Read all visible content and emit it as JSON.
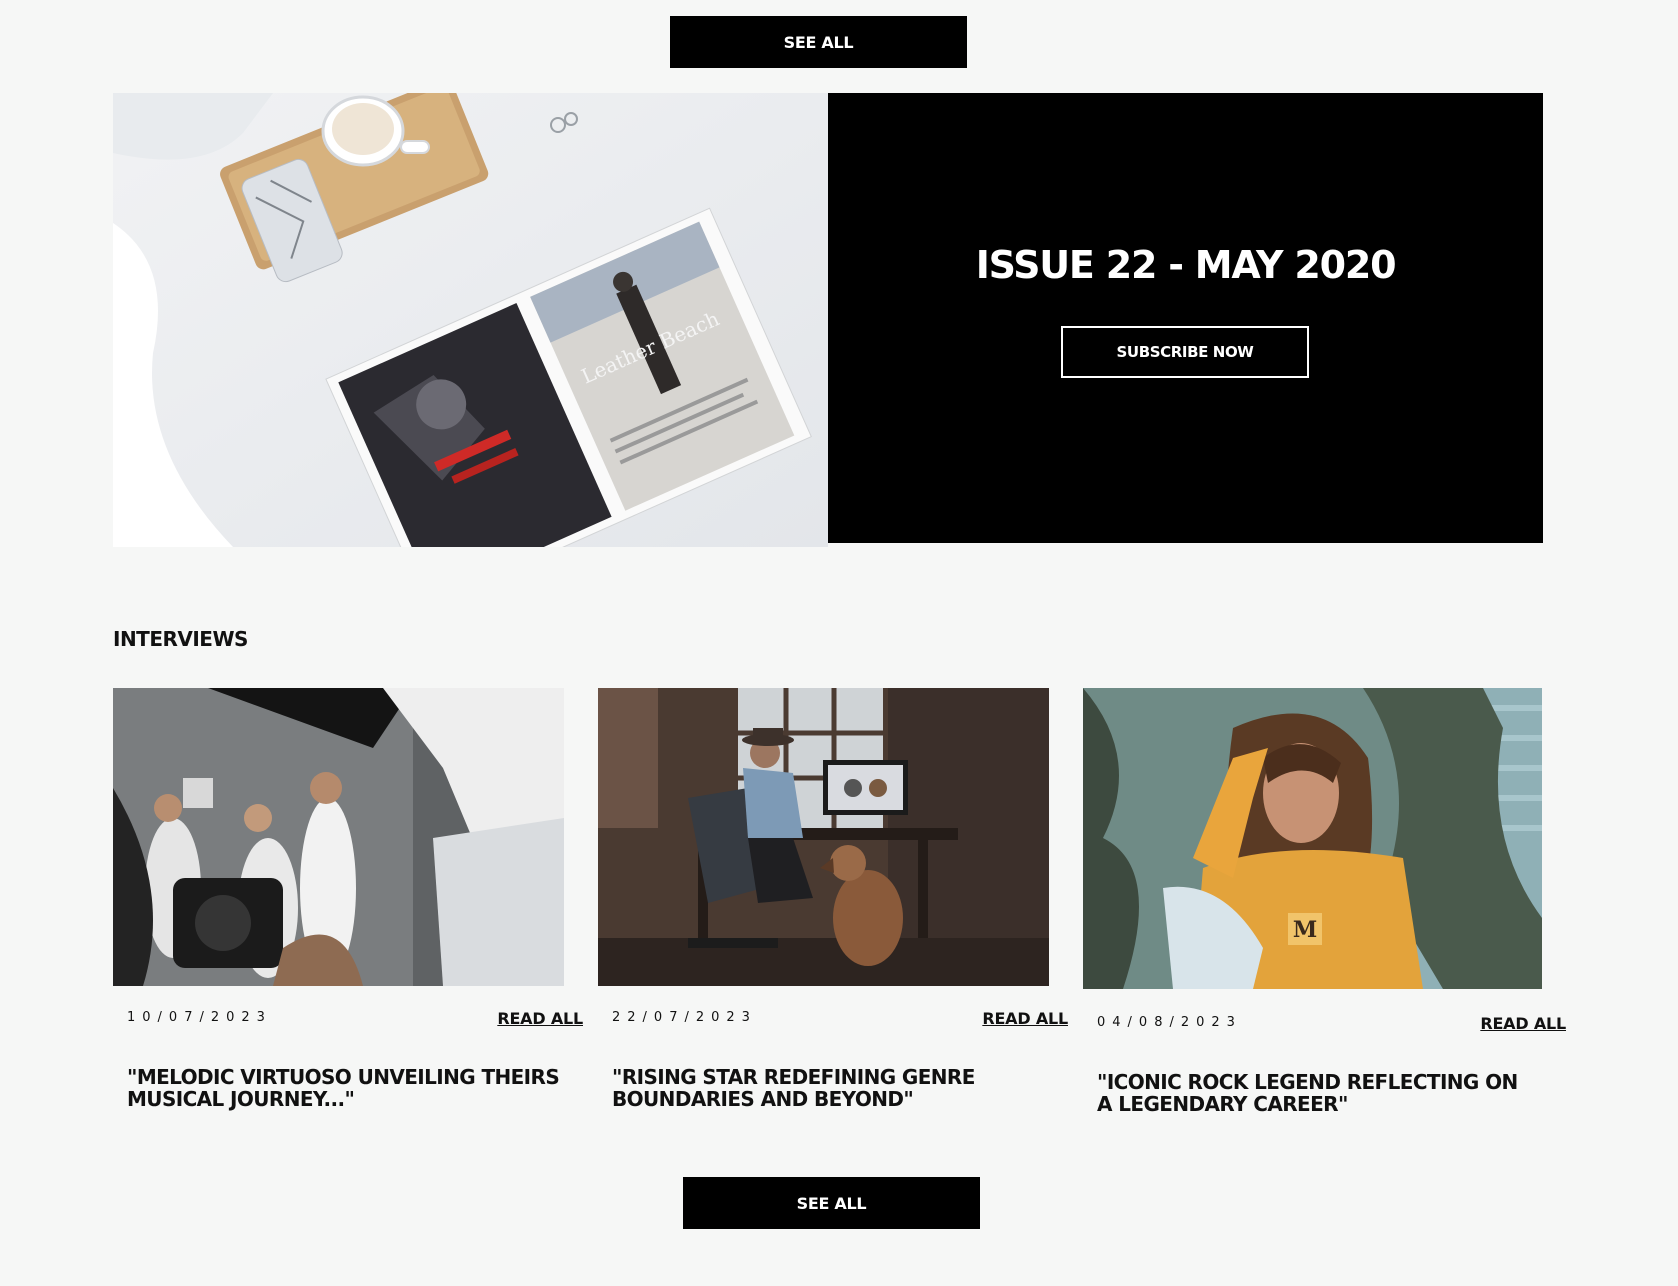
{
  "top": {
    "see_all_label": "SEE ALL"
  },
  "hero": {
    "title": "ISSUE 22 - MAY 2020",
    "subscribe_label": "SUBSCRIBE NOW",
    "magazine_caption": "Leather Beach"
  },
  "interviews": {
    "section_title": "INTERVIEWS",
    "cards": [
      {
        "date": "10/07/2023",
        "read_label": "READ ALL",
        "headline": "\"MELODIC VIRTUOSO UNVEILING THEIRS MUSICAL JOURNEY...\""
      },
      {
        "date": "22/07/2023",
        "read_label": "READ ALL",
        "headline": "\"RISING STAR REDEFINING GENRE BOUNDARIES AND BEYOND\""
      },
      {
        "date": "04/08/2023",
        "read_label": "READ ALL",
        "headline": "\"ICONIC ROCK LEGEND REFLECTING ON A LEGENDARY CAREER\""
      }
    ]
  },
  "bottom": {
    "see_all_label": "SEE ALL"
  },
  "colors": {
    "background": "#f6f7f6",
    "accent": "#000000",
    "text": "#111111"
  }
}
